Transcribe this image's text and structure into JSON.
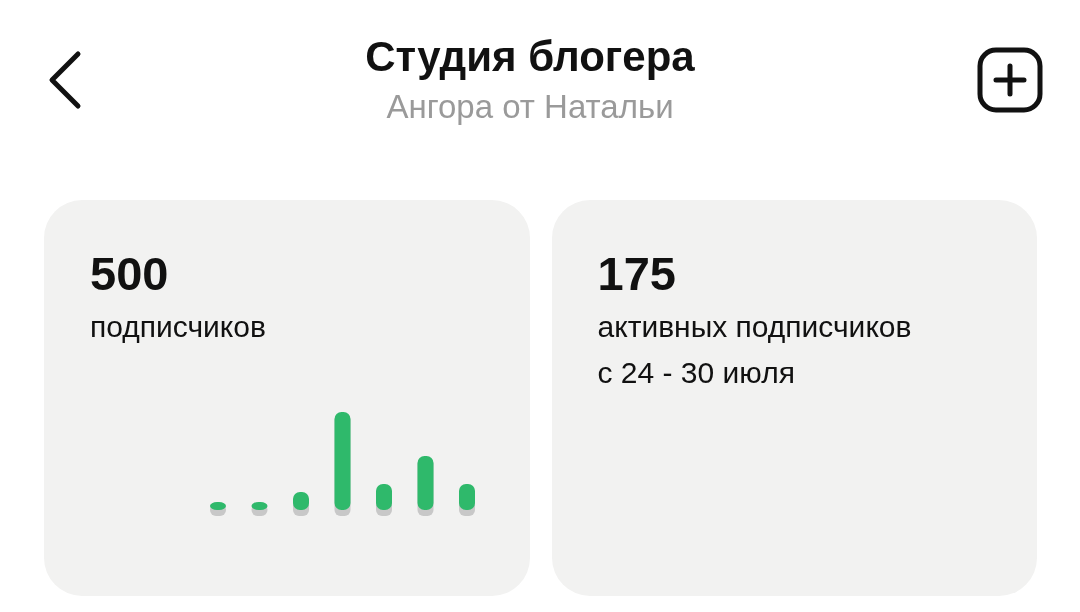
{
  "header": {
    "title": "Студия блогера",
    "subtitle": "Ангора от Натальи"
  },
  "cards": [
    {
      "kind": "chart",
      "value": "500",
      "label": "подписчиков"
    },
    {
      "kind": "text",
      "value": "175",
      "label": "активных подписчиков",
      "period": "с 24 - 30 июля"
    }
  ]
}
